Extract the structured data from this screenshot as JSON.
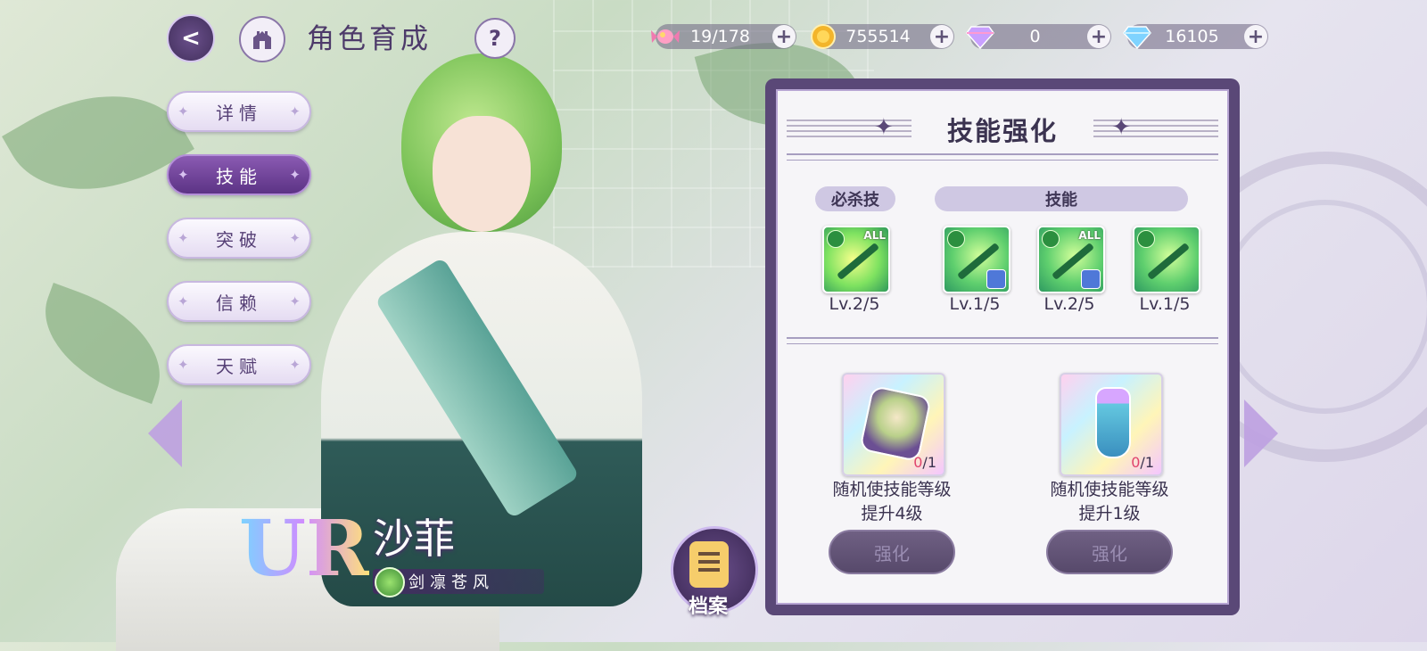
{
  "header": {
    "title": "角色育成",
    "back_glyph": "<",
    "help_glyph": "?"
  },
  "resources": [
    {
      "icon": "candy-icon",
      "value": "19/178"
    },
    {
      "icon": "gold-coin-icon",
      "value": "755514"
    },
    {
      "icon": "rainbow-diamond-icon",
      "value": "0"
    },
    {
      "icon": "blue-diamond-icon",
      "value": "16105"
    }
  ],
  "plus_glyph": "+",
  "tabs": [
    {
      "label": "详情",
      "active": false
    },
    {
      "label": "技能",
      "active": true
    },
    {
      "label": "突破",
      "active": false
    },
    {
      "label": "信赖",
      "active": false
    },
    {
      "label": "天赋",
      "active": false
    }
  ],
  "character": {
    "rarity": "UR",
    "name": "沙菲",
    "subtitle": "剑凛苍风"
  },
  "archive_label": "档案",
  "panel": {
    "title": "技能强化",
    "ultimate_tab": "必杀技",
    "skills_tab": "技能",
    "skills": [
      {
        "level": "Lv.2/5",
        "badge": "ALL"
      },
      {
        "level": "Lv.1/5",
        "badge": ""
      },
      {
        "level": "Lv.2/5",
        "badge": "ALL"
      },
      {
        "level": "Lv.1/5",
        "badge": ""
      }
    ],
    "items": [
      {
        "have": "0",
        "need": "/1",
        "desc_line1": "随机使技能等级",
        "desc_line2": "提升4级",
        "button": "强化"
      },
      {
        "have": "0",
        "need": "/1",
        "desc_line1": "随机使技能等级",
        "desc_line2": "提升1级",
        "button": "强化"
      }
    ]
  },
  "colors": {
    "panel_border": "#5a4877",
    "active_tab": "#6b3f95",
    "count_red": "#e0436c"
  }
}
